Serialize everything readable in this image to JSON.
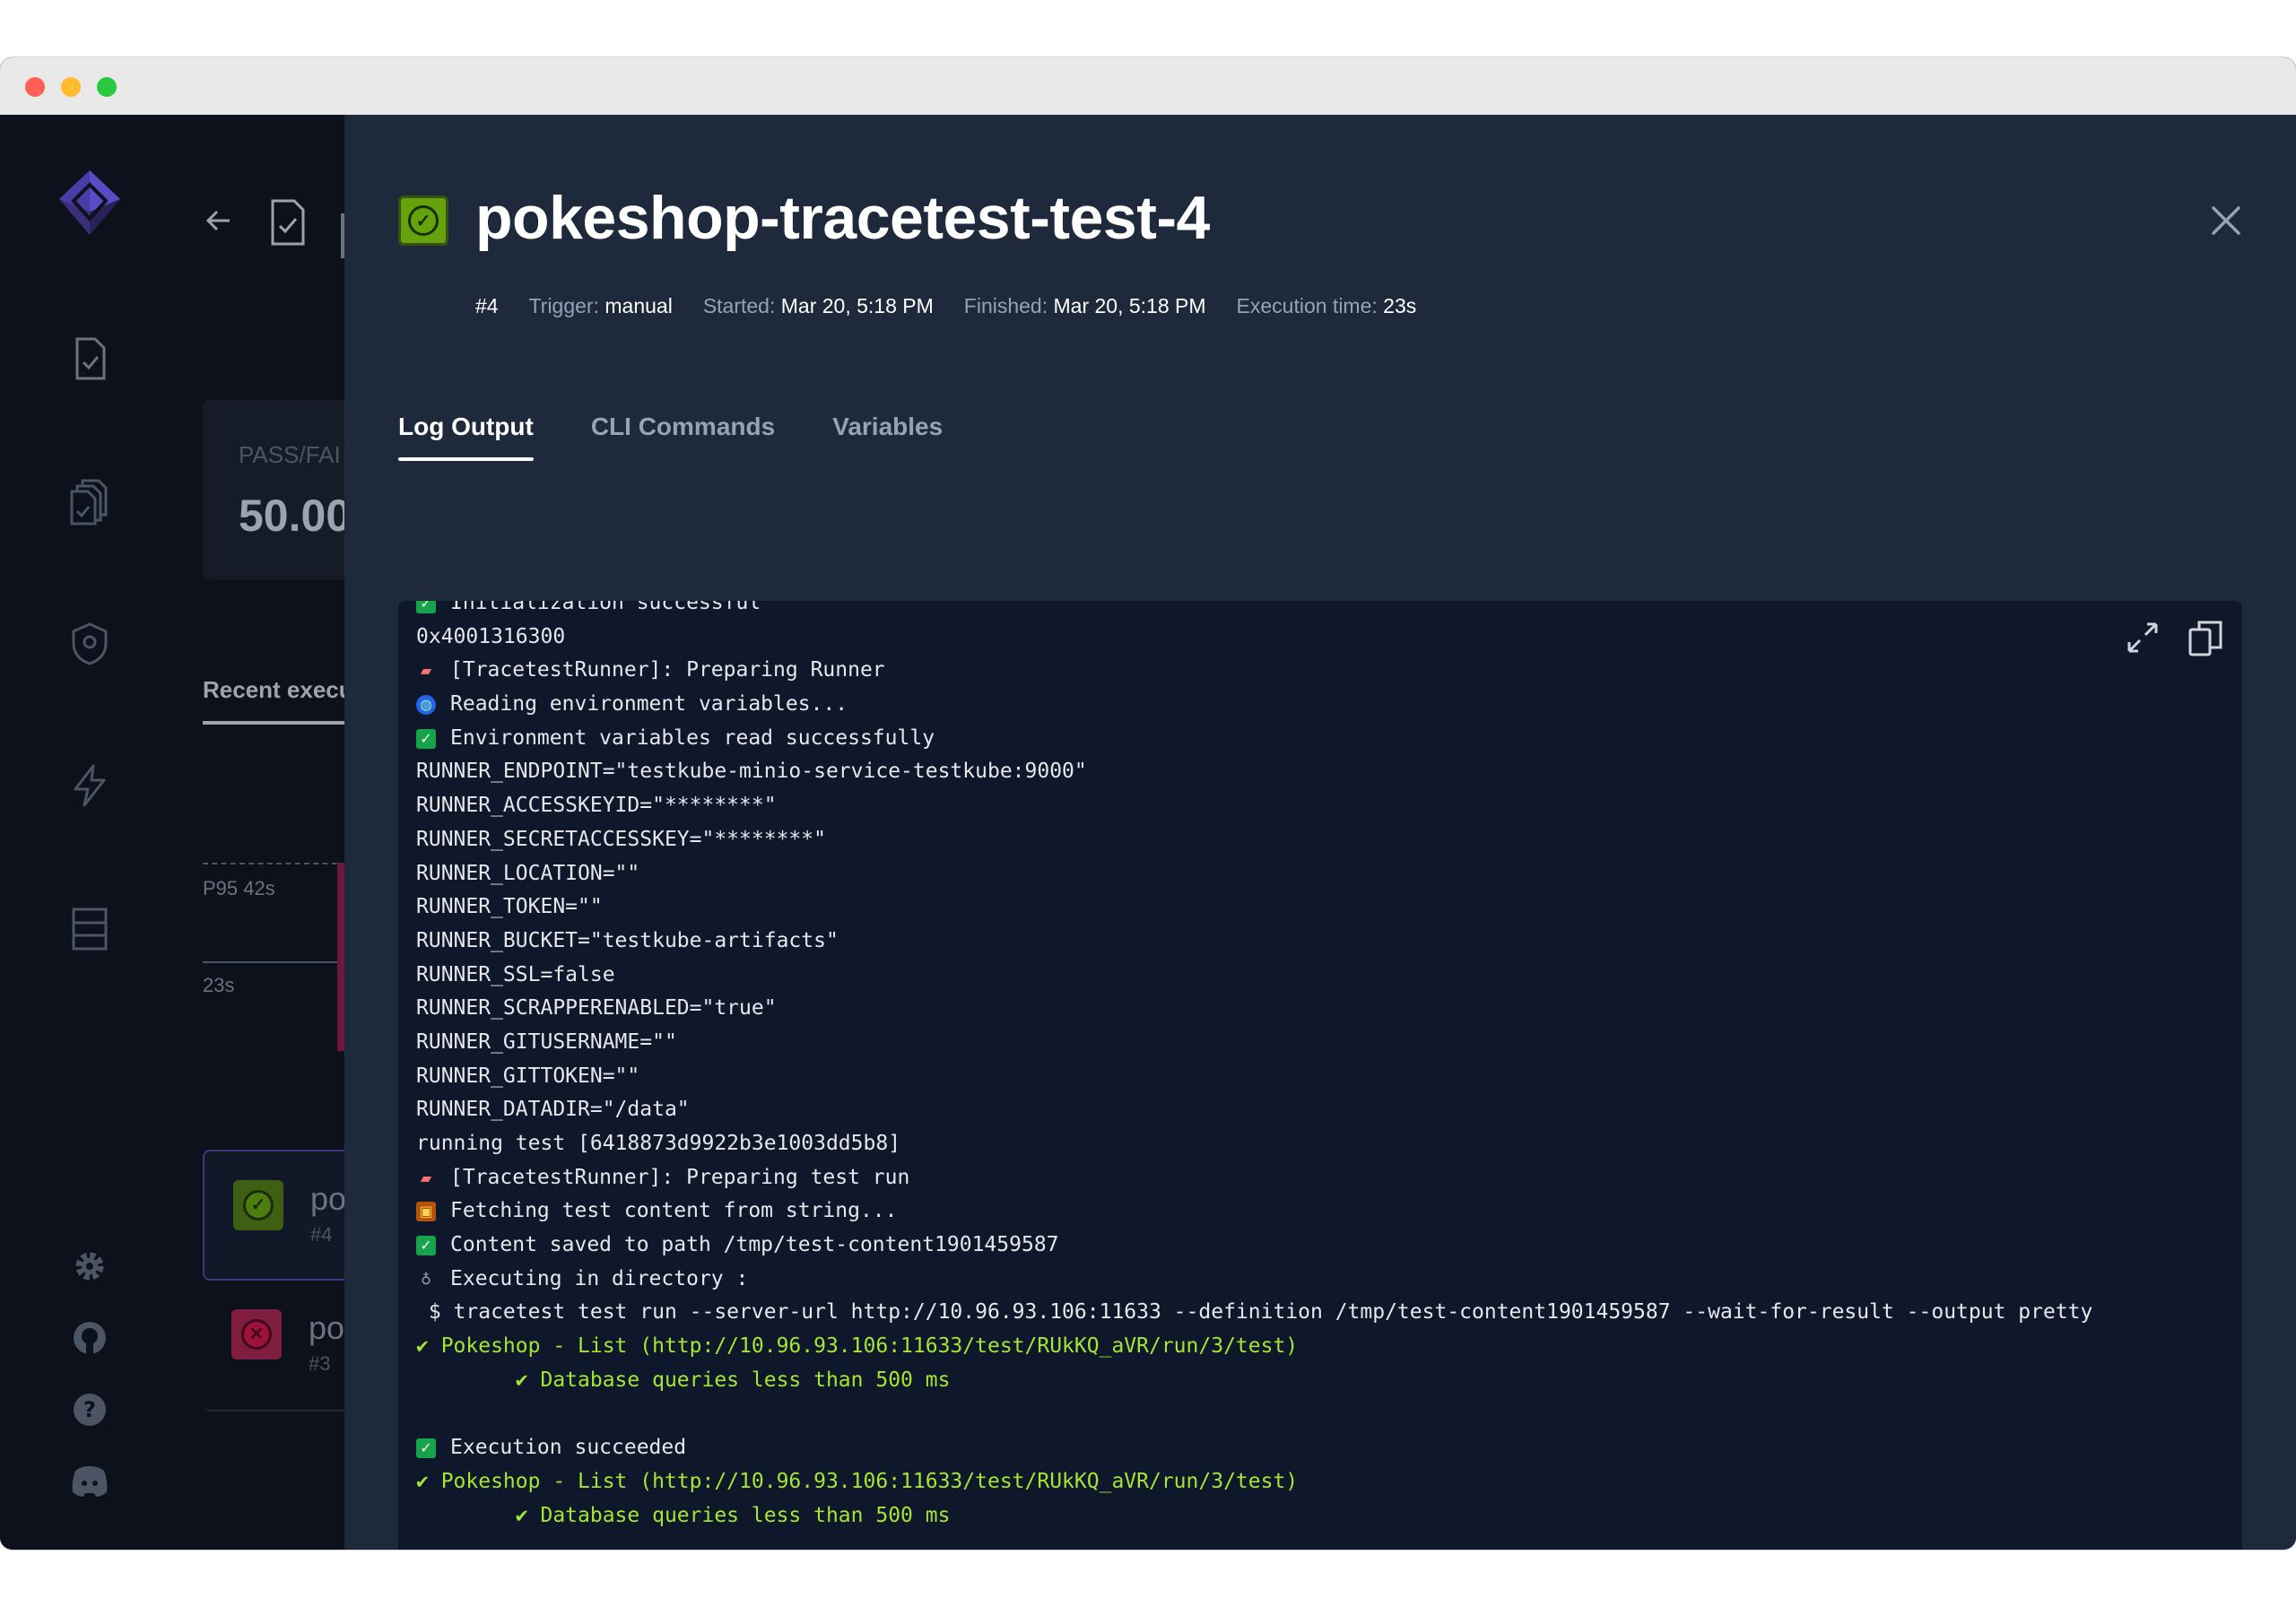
{
  "sidebar": {
    "items": [
      {
        "icon": "logo-icon"
      },
      {
        "icon": "test-file-icon"
      },
      {
        "icon": "test-suites-icon"
      },
      {
        "icon": "shield-icon"
      },
      {
        "icon": "bolt-icon"
      },
      {
        "icon": "server-icon"
      },
      {
        "icon": "gear-icon"
      },
      {
        "icon": "github-icon"
      },
      {
        "icon": "help-icon"
      },
      {
        "icon": "discord-icon"
      }
    ]
  },
  "background": {
    "stat_label": "PASS/FAI",
    "stat_value": "50.00",
    "recent_label": "Recent execu",
    "p95_label": "P95 42s",
    "median_label": "23s",
    "items": [
      {
        "name": "po",
        "number": "#4",
        "status": "passed"
      },
      {
        "name": "po",
        "number": "#3",
        "status": "failed"
      }
    ]
  },
  "drawer": {
    "title": "pokeshop-tracetest-test-4",
    "status": "passed",
    "meta": {
      "number": "#4",
      "trigger_label": "Trigger:",
      "trigger_value": "manual",
      "started_label": "Started:",
      "started_value": "Mar 20, 5:18 PM",
      "finished_label": "Finished:",
      "finished_value": "Mar 20, 5:18 PM",
      "exec_label": "Execution time:",
      "exec_value": "23s"
    },
    "tabs": [
      {
        "label": "Log Output",
        "active": true
      },
      {
        "label": "CLI Commands",
        "active": false
      },
      {
        "label": "Variables",
        "active": false
      }
    ],
    "log": [
      {
        "emoji": "check",
        "text": "Initialization successful",
        "color": "default"
      },
      {
        "emoji": "",
        "text": "0x4001316300",
        "color": "default"
      },
      {
        "emoji": "truck",
        "text": "[TracetestRunner]: Preparing Runner",
        "color": "default"
      },
      {
        "emoji": "globe",
        "text": "Reading environment variables...",
        "color": "default"
      },
      {
        "emoji": "check",
        "text": "Environment variables read successfully",
        "color": "default"
      },
      {
        "emoji": "",
        "text": "RUNNER_ENDPOINT=\"testkube-minio-service-testkube:9000\"",
        "color": "default"
      },
      {
        "emoji": "",
        "text": "RUNNER_ACCESSKEYID=\"********\"",
        "color": "default"
      },
      {
        "emoji": "",
        "text": "RUNNER_SECRETACCESSKEY=\"********\"",
        "color": "default"
      },
      {
        "emoji": "",
        "text": "RUNNER_LOCATION=\"\"",
        "color": "default"
      },
      {
        "emoji": "",
        "text": "RUNNER_TOKEN=\"\"",
        "color": "default"
      },
      {
        "emoji": "",
        "text": "RUNNER_BUCKET=\"testkube-artifacts\"",
        "color": "default"
      },
      {
        "emoji": "",
        "text": "RUNNER_SSL=false",
        "color": "default"
      },
      {
        "emoji": "",
        "text": "RUNNER_SCRAPPERENABLED=\"true\"",
        "color": "default"
      },
      {
        "emoji": "",
        "text": "RUNNER_GITUSERNAME=\"\"",
        "color": "default"
      },
      {
        "emoji": "",
        "text": "RUNNER_GITTOKEN=\"\"",
        "color": "default"
      },
      {
        "emoji": "",
        "text": "RUNNER_DATADIR=\"/data\"",
        "color": "default"
      },
      {
        "emoji": "",
        "text": "running test [6418873d9922b3e1003dd5b8]",
        "color": "default"
      },
      {
        "emoji": "truck",
        "text": "[TracetestRunner]: Preparing test run",
        "color": "default"
      },
      {
        "emoji": "box",
        "text": "Fetching test content from string...",
        "color": "default"
      },
      {
        "emoji": "check",
        "text": "Content saved to path /tmp/test-content1901459587",
        "color": "default"
      },
      {
        "emoji": "scope",
        "text": "Executing in directory :",
        "color": "default"
      },
      {
        "emoji": "",
        "text": " $ tracetest test run --server-url http://10.96.93.106:11633 --definition /tmp/test-content1901459587 --wait-for-result --output pretty",
        "color": "default"
      },
      {
        "emoji": "",
        "text": "✔ Pokeshop - List (http://10.96.93.106:11633/test/RUkKQ_aVR/run/3/test)",
        "color": "green"
      },
      {
        "emoji": "",
        "text": "        ✔ Database queries less than 500 ms",
        "color": "green"
      },
      {
        "emoji": "",
        "text": "",
        "color": "default"
      },
      {
        "emoji": "check",
        "text": "Execution succeeded",
        "color": "default"
      },
      {
        "emoji": "",
        "text": "✔ Pokeshop - List (http://10.96.93.106:11633/test/RUkKQ_aVR/run/3/test)",
        "color": "green"
      },
      {
        "emoji": "",
        "text": "        ✔ Database queries less than 500 ms",
        "color": "green"
      }
    ]
  },
  "colors": {
    "accent_green": "#a3e635",
    "passed": "#65a30d",
    "failed": "#be123c",
    "drawer_bg": "#1e293b",
    "log_bg": "#0f172a"
  }
}
